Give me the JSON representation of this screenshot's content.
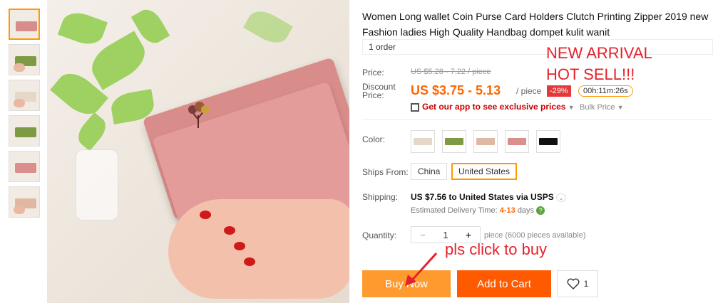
{
  "product": {
    "title": "Women Long wallet Coin Purse Card Holders Clutch Printing Zipper 2019 new Fashion ladies High Quality Handbag dompet kulit wanit",
    "orders": "1 order"
  },
  "price": {
    "label": "Price:",
    "old": "US $5.28 - 7.22 / piece",
    "discount_label_1": "Discount",
    "discount_label_2": "Price:",
    "current": "US $3.75 - 5.13",
    "unit": "/ piece",
    "discount_badge": "-29%",
    "timer": "00h:11m:26s"
  },
  "promo": {
    "app_text": "Get our app to see exclusive prices",
    "bulk": "Bulk Price"
  },
  "color": {
    "label": "Color:",
    "swatches": [
      "#e6d8c8",
      "#7f9a45",
      "#e0b7a3",
      "#d98f8b",
      "#111111"
    ]
  },
  "ships_from": {
    "label": "Ships From:",
    "options": [
      "China",
      "United States"
    ],
    "selected": "United States"
  },
  "shipping": {
    "label": "Shipping:",
    "value": "US $7.56 to United States via USPS",
    "delivery_prefix": "Estimated Delivery Time:",
    "delivery_days": "4-13",
    "delivery_suffix": "days"
  },
  "quantity": {
    "label": "Quantity:",
    "minus": "−",
    "value": "1",
    "plus": "+",
    "note": "piece (6000 pieces available)"
  },
  "actions": {
    "buy_now": "Buy Now",
    "add_to_cart": "Add to Cart",
    "wishlist_count": "1"
  },
  "annotations": {
    "line1": "NEW ARRIVAL",
    "line2": "HOT SELL!!!",
    "click": "pls click to buy"
  },
  "colors": {
    "accent": "#ff9a2e",
    "cart": "#ff5a00",
    "price": "#ff6600",
    "annotation": "#e4222b"
  }
}
